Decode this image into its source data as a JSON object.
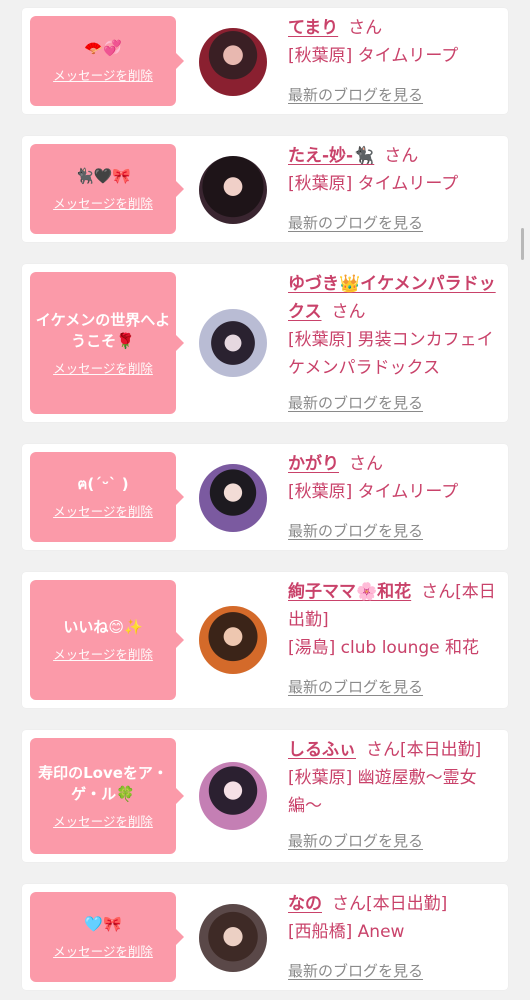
{
  "delete_label": "メッセージを削除",
  "blog_label": "最新のブログを見る",
  "san": "さん",
  "cards": [
    {
      "message": "🪭💞",
      "name": "てまり",
      "status": "",
      "shop": "[秋葉原] タイムリープ"
    },
    {
      "message": "🐈‍⬛🖤🎀",
      "name": "たえ-妙-🐈‍⬛",
      "status": "",
      "shop": "[秋葉原] タイムリープ"
    },
    {
      "message": "イケメンの世界へようこそ🌹",
      "name": "ゆづき👑イケメンパラドックス",
      "status": "",
      "shop": "[秋葉原] 男装コンカフェイケメンパラドックス"
    },
    {
      "message": "ฅ(ˊᵕˋ )",
      "name": "かがり",
      "status": "",
      "shop": "[秋葉原] タイムリープ"
    },
    {
      "message": "いいね😊✨",
      "name": "絢子ママ🌸和花",
      "status": "[本日出勤]",
      "shop": "[湯島] club lounge 和花"
    },
    {
      "message": "寿印のLoveをア・ゲ・ル🍀",
      "name": "しるふぃ",
      "status": "[本日出勤]",
      "shop": "[秋葉原] 幽遊屋敷〜霊女編〜"
    },
    {
      "message": "🩵🎀",
      "name": "なの",
      "status": "[本日出勤]",
      "shop": "[西船橋] Anew"
    }
  ],
  "colors": {
    "bubble": "#fb9aa9",
    "name": "#c9426a",
    "link": "#8a8a8a",
    "background": "#f1f1f1"
  },
  "avatar_tones": [
    "#3a1f24",
    "#2b1a22",
    "#8c8fa8",
    "#5b4a66",
    "#6b3d2a",
    "#c9a6c4",
    "#4a3838"
  ]
}
